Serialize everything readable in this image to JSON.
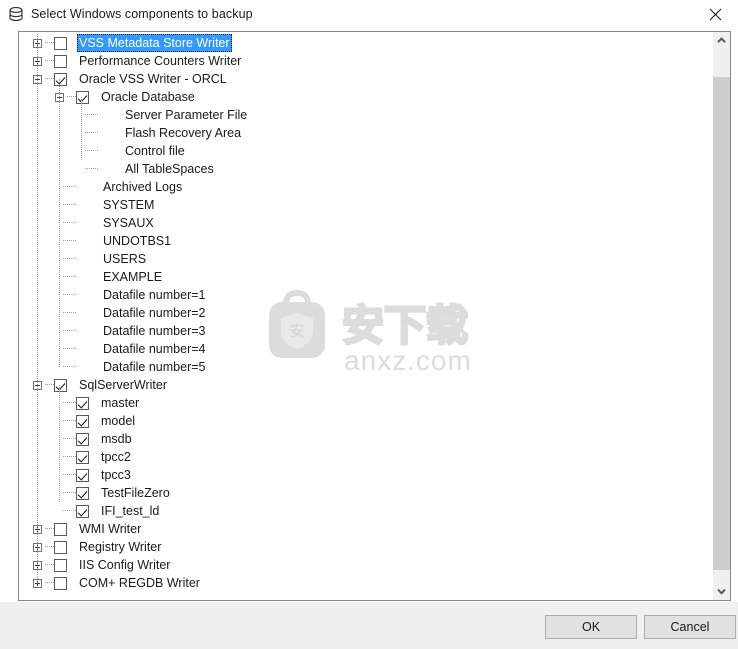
{
  "window": {
    "title": "Select Windows components to backup",
    "icon": "database-icon",
    "close_label": "✕"
  },
  "tree": {
    "nodes": [
      {
        "label": "VSS Metadata Store Writer",
        "level": 0,
        "expander": "plus",
        "checkbox": "unchecked",
        "selected": true
      },
      {
        "label": "Performance Counters Writer",
        "level": 0,
        "expander": "plus",
        "checkbox": "unchecked",
        "selected": false
      },
      {
        "label": "Oracle VSS Writer - ORCL",
        "level": 0,
        "expander": "minus",
        "checkbox": "checked",
        "selected": false
      },
      {
        "label": "Oracle Database",
        "level": 1,
        "expander": "minus",
        "checkbox": "checked",
        "selected": false
      },
      {
        "label": "Server Parameter File",
        "level": 2,
        "expander": "none",
        "checkbox": "none",
        "selected": false
      },
      {
        "label": "Flash Recovery Area",
        "level": 2,
        "expander": "none",
        "checkbox": "none",
        "selected": false
      },
      {
        "label": "Control file",
        "level": 2,
        "expander": "none",
        "checkbox": "none",
        "selected": false
      },
      {
        "label": "All TableSpaces",
        "level": 2,
        "expander": "none",
        "checkbox": "none",
        "selected": false
      },
      {
        "label": "Archived Logs",
        "level": 1,
        "expander": "none",
        "checkbox": "none",
        "selected": false
      },
      {
        "label": "SYSTEM",
        "level": 1,
        "expander": "none",
        "checkbox": "none",
        "selected": false
      },
      {
        "label": "SYSAUX",
        "level": 1,
        "expander": "none",
        "checkbox": "none",
        "selected": false
      },
      {
        "label": "UNDOTBS1",
        "level": 1,
        "expander": "none",
        "checkbox": "none",
        "selected": false
      },
      {
        "label": "USERS",
        "level": 1,
        "expander": "none",
        "checkbox": "none",
        "selected": false
      },
      {
        "label": "EXAMPLE",
        "level": 1,
        "expander": "none",
        "checkbox": "none",
        "selected": false
      },
      {
        "label": "Datafile number=1",
        "level": 1,
        "expander": "none",
        "checkbox": "none",
        "selected": false
      },
      {
        "label": "Datafile number=2",
        "level": 1,
        "expander": "none",
        "checkbox": "none",
        "selected": false
      },
      {
        "label": "Datafile number=3",
        "level": 1,
        "expander": "none",
        "checkbox": "none",
        "selected": false
      },
      {
        "label": "Datafile number=4",
        "level": 1,
        "expander": "none",
        "checkbox": "none",
        "selected": false
      },
      {
        "label": "Datafile number=5",
        "level": 1,
        "expander": "none",
        "checkbox": "none",
        "selected": false
      },
      {
        "label": "SqlServerWriter",
        "level": 0,
        "expander": "minus",
        "checkbox": "checked",
        "selected": false
      },
      {
        "label": "master",
        "level": 1,
        "expander": "none",
        "checkbox": "checked",
        "selected": false
      },
      {
        "label": "model",
        "level": 1,
        "expander": "none",
        "checkbox": "checked",
        "selected": false
      },
      {
        "label": "msdb",
        "level": 1,
        "expander": "none",
        "checkbox": "checked",
        "selected": false
      },
      {
        "label": "tpcc2",
        "level": 1,
        "expander": "none",
        "checkbox": "checked",
        "selected": false
      },
      {
        "label": "tpcc3",
        "level": 1,
        "expander": "none",
        "checkbox": "checked",
        "selected": false
      },
      {
        "label": "TestFileZero",
        "level": 1,
        "expander": "none",
        "checkbox": "checked",
        "selected": false
      },
      {
        "label": "IFI_test_ld",
        "level": 1,
        "expander": "none",
        "checkbox": "checked",
        "selected": false
      },
      {
        "label": "WMI Writer",
        "level": 0,
        "expander": "plus",
        "checkbox": "unchecked",
        "selected": false
      },
      {
        "label": "Registry Writer",
        "level": 0,
        "expander": "plus",
        "checkbox": "unchecked",
        "selected": false
      },
      {
        "label": "IIS Config Writer",
        "level": 0,
        "expander": "plus",
        "checkbox": "unchecked",
        "selected": false
      },
      {
        "label": "COM+ REGDB Writer",
        "level": 0,
        "expander": "plus",
        "checkbox": "unchecked",
        "selected": false
      }
    ]
  },
  "scrollbar": {
    "up_arrow": "▲",
    "down_arrow": "▼"
  },
  "watermark": {
    "text": "anxz.com",
    "cn_text": "安下载",
    "badge_text": "安",
    "color": "#dcdcdc"
  },
  "footer": {
    "ok_label": "OK",
    "cancel_label": "Cancel"
  },
  "colors": {
    "selection": "#3399ff",
    "panel_border": "#828790",
    "footer_bg": "#f0f0f0",
    "scroll_thumb": "#cdcdcd"
  }
}
